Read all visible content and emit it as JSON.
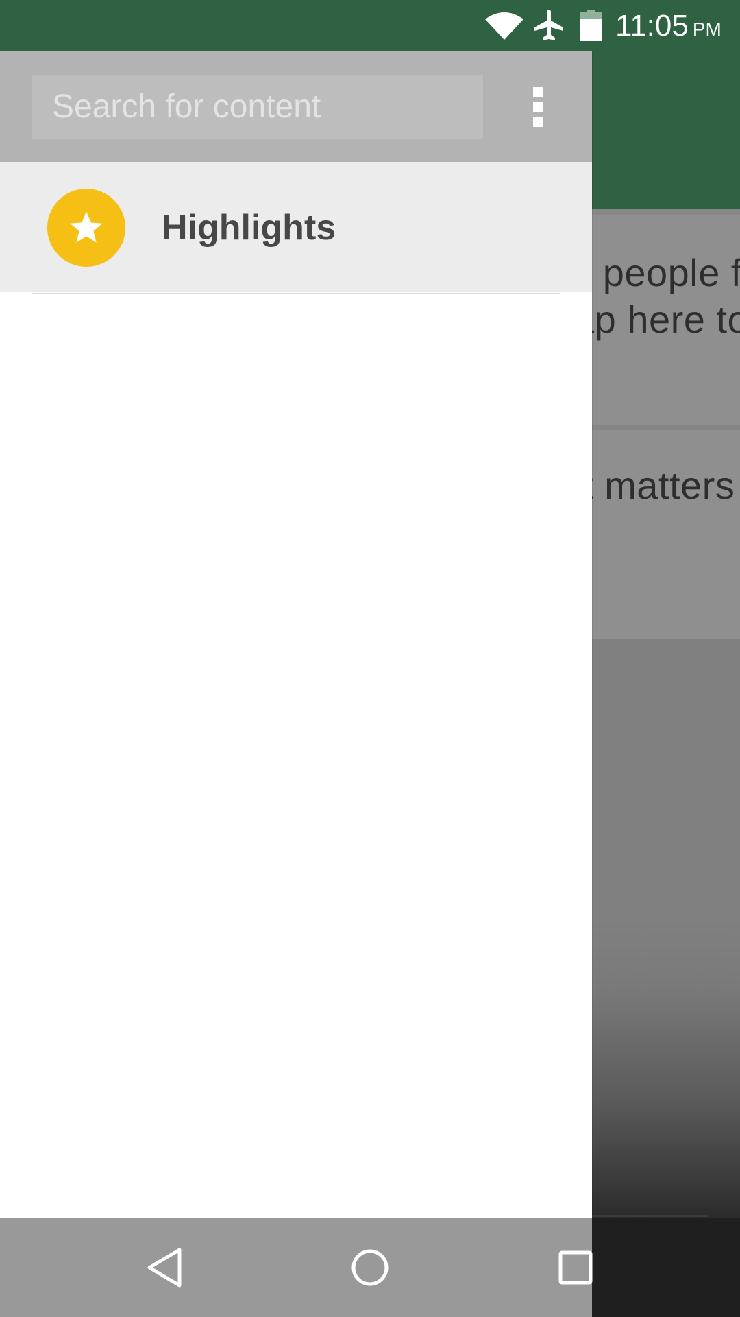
{
  "status_bar": {
    "icons": [
      "wifi-icon",
      "airplane-mode-icon",
      "battery-icon"
    ],
    "time": "11:05",
    "ampm": "PM",
    "color": "#2e6242"
  },
  "background_app": {
    "toolbar_color": "#2e6242",
    "cards": [
      {
        "lines": [
          "n people f",
          "ap here to"
        ]
      },
      {
        "lines": [
          "t matters"
        ]
      }
    ]
  },
  "drawer": {
    "search": {
      "placeholder": "Search for content",
      "value": ""
    },
    "overflow_menu_icon": "more-vert-icon",
    "items": [
      {
        "label": "Highlights",
        "icon": "star-icon",
        "icon_color": "#f5bf14",
        "selected": true
      }
    ]
  },
  "nav_bar": {
    "buttons": [
      {
        "name": "back",
        "icon": "back-triangle-icon"
      },
      {
        "name": "home",
        "icon": "home-circle-icon"
      },
      {
        "name": "recents",
        "icon": "recents-square-icon"
      }
    ]
  }
}
